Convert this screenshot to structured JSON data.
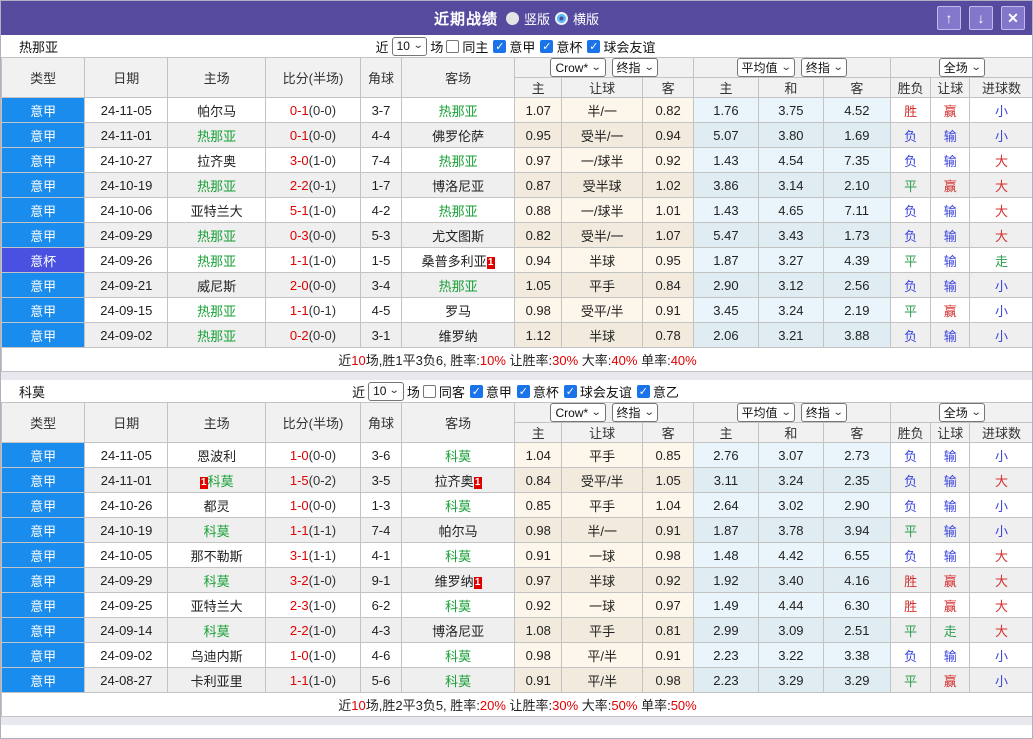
{
  "titlebar": {
    "title": "近期战绩",
    "vertical_label": "竖版",
    "horizontal_label": "横版",
    "buttons": {
      "up": "↑",
      "down": "↓",
      "close": "✕"
    }
  },
  "colors": {
    "titlebar_bg": "#554a9e",
    "type_serie_a": "#1a8cee",
    "type_cup": "#4a50e0",
    "focus_team": "#17a036",
    "score_red": "#e00000",
    "win_red": "#d43030",
    "draw_green": "#2f9e4f",
    "loss_blue": "#3c45dd",
    "summary_red": "#e00000",
    "odds_col_bg": "#fdf6ea",
    "avg_col_bg": "#e9f5fa"
  },
  "table_columns": {
    "left": [
      "类型",
      "日期",
      "主场",
      "比分(半场)",
      "角球",
      "客场"
    ],
    "sub": [
      "主",
      "让球",
      "客",
      "主",
      "和",
      "客",
      "胜负",
      "让球",
      "进球数"
    ]
  },
  "table_controls": {
    "odds_source": "Crow*",
    "odds_final": "终指",
    "avg": "平均值",
    "avg_final": "终指",
    "scope": "全场"
  },
  "sections": [
    {
      "team": "热那亚",
      "filter": {
        "near_label": "近",
        "count": "10",
        "games_label": "场",
        "same": {
          "label": "同主",
          "checked": false
        },
        "leagues": [
          {
            "label": "意甲",
            "checked": true
          },
          {
            "label": "意杯",
            "checked": true
          },
          {
            "label": "球会友谊",
            "checked": true
          }
        ]
      },
      "rows": [
        {
          "type": "意甲",
          "date": "24-11-05",
          "home": {
            "name": "帕尔马",
            "focus": false
          },
          "score": {
            "ft": "0-1",
            "ht": "(0-0)"
          },
          "corner": "3-7",
          "away": {
            "name": "热那亚",
            "focus": true
          },
          "odds": [
            "1.07",
            "半/一",
            "0.82"
          ],
          "avg": [
            "1.76",
            "3.75",
            "4.52"
          ],
          "result": [
            "胜",
            "赢",
            "小"
          ]
        },
        {
          "type": "意甲",
          "date": "24-11-01",
          "home": {
            "name": "热那亚",
            "focus": true
          },
          "score": {
            "ft": "0-1",
            "ht": "(0-0)"
          },
          "corner": "4-4",
          "away": {
            "name": "佛罗伦萨",
            "focus": false
          },
          "odds": [
            "0.95",
            "受半/一",
            "0.94"
          ],
          "avg": [
            "5.07",
            "3.80",
            "1.69"
          ],
          "result": [
            "负",
            "输",
            "小"
          ]
        },
        {
          "type": "意甲",
          "date": "24-10-27",
          "home": {
            "name": "拉齐奥",
            "focus": false
          },
          "score": {
            "ft": "3-0",
            "ht": "(1-0)"
          },
          "corner": "7-4",
          "away": {
            "name": "热那亚",
            "focus": true
          },
          "odds": [
            "0.97",
            "一/球半",
            "0.92"
          ],
          "avg": [
            "1.43",
            "4.54",
            "7.35"
          ],
          "result": [
            "负",
            "输",
            "大"
          ]
        },
        {
          "type": "意甲",
          "date": "24-10-19",
          "home": {
            "name": "热那亚",
            "focus": true
          },
          "score": {
            "ft": "2-2",
            "ht": "(0-1)"
          },
          "corner": "1-7",
          "away": {
            "name": "博洛尼亚",
            "focus": false
          },
          "odds": [
            "0.87",
            "受半球",
            "1.02"
          ],
          "avg": [
            "3.86",
            "3.14",
            "2.10"
          ],
          "result": [
            "平",
            "赢",
            "大"
          ]
        },
        {
          "type": "意甲",
          "date": "24-10-06",
          "home": {
            "name": "亚特兰大",
            "focus": false
          },
          "score": {
            "ft": "5-1",
            "ht": "(1-0)"
          },
          "corner": "4-2",
          "away": {
            "name": "热那亚",
            "focus": true
          },
          "odds": [
            "0.88",
            "一/球半",
            "1.01"
          ],
          "avg": [
            "1.43",
            "4.65",
            "7.11"
          ],
          "result": [
            "负",
            "输",
            "大"
          ]
        },
        {
          "type": "意甲",
          "date": "24-09-29",
          "home": {
            "name": "热那亚",
            "focus": true
          },
          "score": {
            "ft": "0-3",
            "ht": "(0-0)"
          },
          "corner": "5-3",
          "away": {
            "name": "尤文图斯",
            "focus": false
          },
          "odds": [
            "0.82",
            "受半/一",
            "1.07"
          ],
          "avg": [
            "5.47",
            "3.43",
            "1.73"
          ],
          "result": [
            "负",
            "输",
            "大"
          ]
        },
        {
          "type": "意杯",
          "date": "24-09-26",
          "home": {
            "name": "热那亚",
            "focus": true
          },
          "score": {
            "ft": "1-1",
            "ht": "(1-0)"
          },
          "corner": "1-5",
          "away": {
            "name": "桑普多利亚",
            "focus": false,
            "badge": "1",
            "badge_pos": "after"
          },
          "odds": [
            "0.94",
            "半球",
            "0.95"
          ],
          "avg": [
            "1.87",
            "3.27",
            "4.39"
          ],
          "result": [
            "平",
            "输",
            "走"
          ]
        },
        {
          "type": "意甲",
          "date": "24-09-21",
          "home": {
            "name": "威尼斯",
            "focus": false
          },
          "score": {
            "ft": "2-0",
            "ht": "(0-0)"
          },
          "corner": "3-4",
          "away": {
            "name": "热那亚",
            "focus": true
          },
          "odds": [
            "1.05",
            "平手",
            "0.84"
          ],
          "avg": [
            "2.90",
            "3.12",
            "2.56"
          ],
          "result": [
            "负",
            "输",
            "小"
          ]
        },
        {
          "type": "意甲",
          "date": "24-09-15",
          "home": {
            "name": "热那亚",
            "focus": true
          },
          "score": {
            "ft": "1-1",
            "ht": "(0-1)"
          },
          "corner": "4-5",
          "away": {
            "name": "罗马",
            "focus": false
          },
          "odds": [
            "0.98",
            "受平/半",
            "0.91"
          ],
          "avg": [
            "3.45",
            "3.24",
            "2.19"
          ],
          "result": [
            "平",
            "赢",
            "小"
          ]
        },
        {
          "type": "意甲",
          "date": "24-09-02",
          "home": {
            "name": "热那亚",
            "focus": true
          },
          "score": {
            "ft": "0-2",
            "ht": "(0-0)"
          },
          "corner": "3-1",
          "away": {
            "name": "维罗纳",
            "focus": false
          },
          "odds": [
            "1.12",
            "半球",
            "0.78"
          ],
          "avg": [
            "2.06",
            "3.21",
            "3.88"
          ],
          "result": [
            "负",
            "输",
            "小"
          ]
        }
      ],
      "summary": [
        {
          "text": "近",
          "red": false
        },
        {
          "text": "10",
          "red": true
        },
        {
          "text": "场,胜1平3负6, 胜率:",
          "red": false
        },
        {
          "text": "10%",
          "red": true
        },
        {
          "text": " 让胜率:",
          "red": false
        },
        {
          "text": "30%",
          "red": true
        },
        {
          "text": " 大率:",
          "red": false
        },
        {
          "text": "40%",
          "red": true
        },
        {
          "text": " 单率:",
          "red": false
        },
        {
          "text": "40%",
          "red": true
        }
      ]
    },
    {
      "team": "科莫",
      "filter": {
        "near_label": "近",
        "count": "10",
        "games_label": "场",
        "same": {
          "label": "同客",
          "checked": false
        },
        "leagues": [
          {
            "label": "意甲",
            "checked": true
          },
          {
            "label": "意杯",
            "checked": true
          },
          {
            "label": "球会友谊",
            "checked": true
          },
          {
            "label": "意乙",
            "checked": true
          }
        ]
      },
      "rows": [
        {
          "type": "意甲",
          "date": "24-11-05",
          "home": {
            "name": "恩波利",
            "focus": false
          },
          "score": {
            "ft": "1-0",
            "ht": "(0-0)"
          },
          "corner": "3-6",
          "away": {
            "name": "科莫",
            "focus": true
          },
          "odds": [
            "1.04",
            "平手",
            "0.85"
          ],
          "avg": [
            "2.76",
            "3.07",
            "2.73"
          ],
          "result": [
            "负",
            "输",
            "小"
          ]
        },
        {
          "type": "意甲",
          "date": "24-11-01",
          "home": {
            "name": "科莫",
            "focus": true,
            "badge": "1",
            "badge_pos": "before"
          },
          "score": {
            "ft": "1-5",
            "ht": "(0-2)"
          },
          "corner": "3-5",
          "away": {
            "name": "拉齐奥",
            "focus": false,
            "badge": "1",
            "badge_pos": "after"
          },
          "odds": [
            "0.84",
            "受平/半",
            "1.05"
          ],
          "avg": [
            "3.11",
            "3.24",
            "2.35"
          ],
          "result": [
            "负",
            "输",
            "大"
          ]
        },
        {
          "type": "意甲",
          "date": "24-10-26",
          "home": {
            "name": "都灵",
            "focus": false
          },
          "score": {
            "ft": "1-0",
            "ht": "(0-0)"
          },
          "corner": "1-3",
          "away": {
            "name": "科莫",
            "focus": true
          },
          "odds": [
            "0.85",
            "平手",
            "1.04"
          ],
          "avg": [
            "2.64",
            "3.02",
            "2.90"
          ],
          "result": [
            "负",
            "输",
            "小"
          ]
        },
        {
          "type": "意甲",
          "date": "24-10-19",
          "home": {
            "name": "科莫",
            "focus": true
          },
          "score": {
            "ft": "1-1",
            "ht": "(1-1)"
          },
          "corner": "7-4",
          "away": {
            "name": "帕尔马",
            "focus": false
          },
          "odds": [
            "0.98",
            "半/一",
            "0.91"
          ],
          "avg": [
            "1.87",
            "3.78",
            "3.94"
          ],
          "result": [
            "平",
            "输",
            "小"
          ]
        },
        {
          "type": "意甲",
          "date": "24-10-05",
          "home": {
            "name": "那不勒斯",
            "focus": false
          },
          "score": {
            "ft": "3-1",
            "ht": "(1-1)"
          },
          "corner": "4-1",
          "away": {
            "name": "科莫",
            "focus": true
          },
          "odds": [
            "0.91",
            "一球",
            "0.98"
          ],
          "avg": [
            "1.48",
            "4.42",
            "6.55"
          ],
          "result": [
            "负",
            "输",
            "大"
          ]
        },
        {
          "type": "意甲",
          "date": "24-09-29",
          "home": {
            "name": "科莫",
            "focus": true
          },
          "score": {
            "ft": "3-2",
            "ht": "(1-0)"
          },
          "corner": "9-1",
          "away": {
            "name": "维罗纳",
            "focus": false,
            "badge": "1",
            "badge_pos": "after"
          },
          "odds": [
            "0.97",
            "半球",
            "0.92"
          ],
          "avg": [
            "1.92",
            "3.40",
            "4.16"
          ],
          "result": [
            "胜",
            "赢",
            "大"
          ]
        },
        {
          "type": "意甲",
          "date": "24-09-25",
          "home": {
            "name": "亚特兰大",
            "focus": false
          },
          "score": {
            "ft": "2-3",
            "ht": "(1-0)"
          },
          "corner": "6-2",
          "away": {
            "name": "科莫",
            "focus": true
          },
          "odds": [
            "0.92",
            "一球",
            "0.97"
          ],
          "avg": [
            "1.49",
            "4.44",
            "6.30"
          ],
          "result": [
            "胜",
            "赢",
            "大"
          ]
        },
        {
          "type": "意甲",
          "date": "24-09-14",
          "home": {
            "name": "科莫",
            "focus": true
          },
          "score": {
            "ft": "2-2",
            "ht": "(1-0)"
          },
          "corner": "4-3",
          "away": {
            "name": "博洛尼亚",
            "focus": false
          },
          "odds": [
            "1.08",
            "平手",
            "0.81"
          ],
          "avg": [
            "2.99",
            "3.09",
            "2.51"
          ],
          "result": [
            "平",
            "走",
            "大"
          ]
        },
        {
          "type": "意甲",
          "date": "24-09-02",
          "home": {
            "name": "乌迪内斯",
            "focus": false
          },
          "score": {
            "ft": "1-0",
            "ht": "(1-0)"
          },
          "corner": "4-6",
          "away": {
            "name": "科莫",
            "focus": true
          },
          "odds": [
            "0.98",
            "平/半",
            "0.91"
          ],
          "avg": [
            "2.23",
            "3.22",
            "3.38"
          ],
          "result": [
            "负",
            "输",
            "小"
          ]
        },
        {
          "type": "意甲",
          "date": "24-08-27",
          "home": {
            "name": "卡利亚里",
            "focus": false
          },
          "score": {
            "ft": "1-1",
            "ht": "(1-0)"
          },
          "corner": "5-6",
          "away": {
            "name": "科莫",
            "focus": true
          },
          "odds": [
            "0.91",
            "平/半",
            "0.98"
          ],
          "avg": [
            "2.23",
            "3.29",
            "3.29"
          ],
          "result": [
            "平",
            "赢",
            "小"
          ]
        }
      ],
      "summary": [
        {
          "text": "近",
          "red": false
        },
        {
          "text": "10",
          "red": true
        },
        {
          "text": "场,胜2平3负5, 胜率:",
          "red": false
        },
        {
          "text": "20%",
          "red": true
        },
        {
          "text": " 让胜率:",
          "red": false
        },
        {
          "text": "30%",
          "red": true
        },
        {
          "text": " 大率:",
          "red": false
        },
        {
          "text": "50%",
          "red": true
        },
        {
          "text": " 单率:",
          "red": false
        },
        {
          "text": "50%",
          "red": true
        }
      ]
    }
  ]
}
